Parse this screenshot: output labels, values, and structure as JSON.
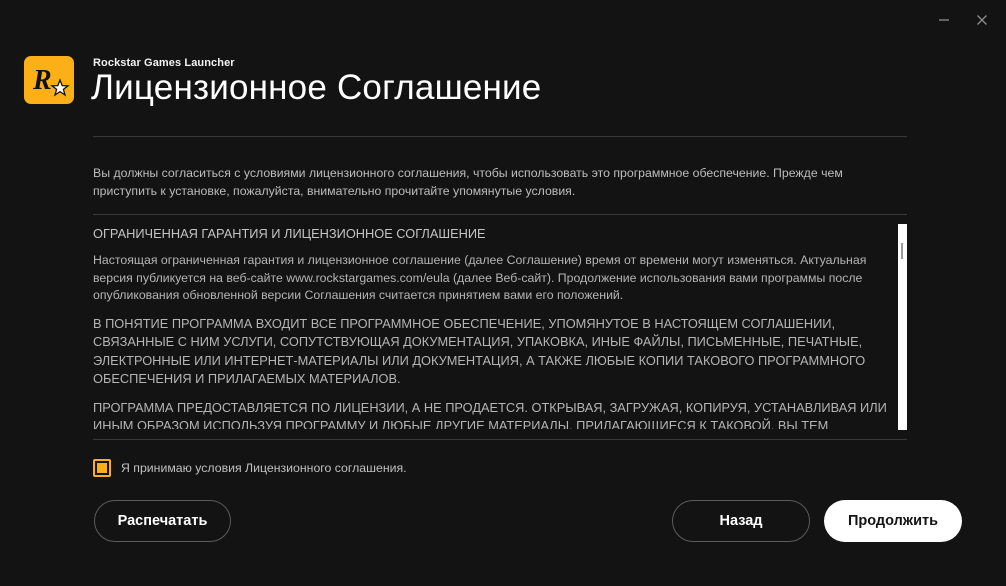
{
  "window": {
    "app_name": "Rockstar Games Launcher",
    "title": "Лицензионное Соглашение",
    "logo_letter": "R"
  },
  "intro_text": "Вы должны согласиться с условиями лицензионного соглашения, чтобы использовать это программное обеспечение. Прежде чем приступить к установке, пожалуйста, внимательно прочитайте упомянутые условия.",
  "eula": {
    "heading": "ОГРАНИЧЕННАЯ ГАРАНТИЯ И ЛИЦЕНЗИОННОЕ СОГЛАШЕНИЕ",
    "paragraph_1": "Настоящая ограниченная гарантия и лицензионное соглашение (далее Соглашение) время от времени могут изменяться. Актуальная версия публикуется на веб-сайте www.rockstargames.com/eula (далее Веб-сайт).  Продолжение использования вами программы после опубликования обновленной версии Соглашения считается принятием вами его положений.",
    "paragraph_2": "В ПОНЯТИЕ ПРОГРАММА ВХОДИТ ВСЕ ПРОГРАММНОЕ ОБЕСПЕЧЕНИЕ, УПОМЯНУТОЕ В НАСТОЯЩЕМ СОГЛАШЕНИИ, СВЯЗАННЫЕ С НИМ УСЛУГИ, СОПУТСТВУЮЩАЯ ДОКУМЕНТАЦИЯ, УПАКОВКА, ИНЫЕ ФАЙЛЫ, ПИСЬМЕННЫЕ, ПЕЧАТНЫЕ, ЭЛЕКТРОННЫЕ ИЛИ ИНТЕРНЕТ-МАТЕРИАЛЫ ИЛИ ДОКУМЕНТАЦИЯ, А ТАКЖЕ ЛЮБЫЕ КОПИИ ТАКОВОГО ПРОГРАММНОГО ОБЕСПЕЧЕНИЯ И ПРИЛАГАЕМЫХ МАТЕРИАЛОВ.",
    "paragraph_3": "ПРОГРАММА ПРЕДОСТАВЛЯЕТСЯ ПО ЛИЦЕНЗИИ, А НЕ ПРОДАЕТСЯ.  ОТКРЫВАЯ, ЗАГРУЖАЯ, КОПИРУЯ, УСТАНАВЛИВАЯ ИЛИ ИНЫМ ОБРАЗОМ ИСПОЛЬЗУЯ ПРОГРАММУ И ЛЮБЫЕ ДРУГИЕ МАТЕРИАЛЫ, ПРИЛАГАЮЩИЕСЯ К ТАКОВОЙ, ВЫ ТЕМ"
  },
  "accept": {
    "label": "Я принимаю условия Лицензионного соглашения.",
    "checked": true
  },
  "buttons": {
    "print": "Распечатать",
    "back": "Назад",
    "continue": "Продолжить"
  },
  "colors": {
    "background": "#131313",
    "accent": "#fcaf17",
    "primary_button": "#ffffff"
  },
  "icons": {
    "minimize": "minimize-icon",
    "close": "close-icon",
    "logo": "rockstar-logo-icon"
  }
}
